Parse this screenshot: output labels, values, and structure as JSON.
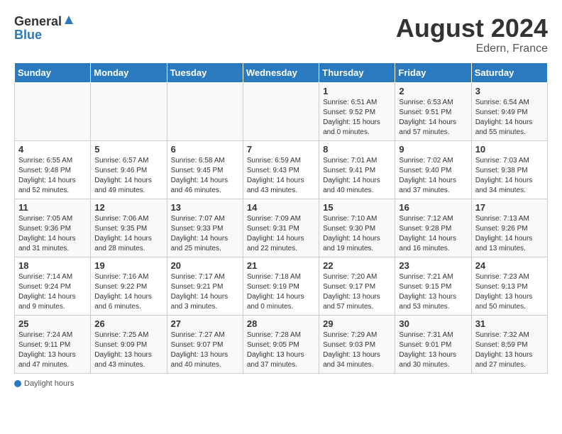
{
  "header": {
    "logo_general": "General",
    "logo_blue": "Blue",
    "month_year": "August 2024",
    "location": "Edern, France"
  },
  "days_of_week": [
    "Sunday",
    "Monday",
    "Tuesday",
    "Wednesday",
    "Thursday",
    "Friday",
    "Saturday"
  ],
  "weeks": [
    [
      {
        "day": "",
        "detail": ""
      },
      {
        "day": "",
        "detail": ""
      },
      {
        "day": "",
        "detail": ""
      },
      {
        "day": "",
        "detail": ""
      },
      {
        "day": "1",
        "detail": "Sunrise: 6:51 AM\nSunset: 9:52 PM\nDaylight: 15 hours\nand 0 minutes."
      },
      {
        "day": "2",
        "detail": "Sunrise: 6:53 AM\nSunset: 9:51 PM\nDaylight: 14 hours\nand 57 minutes."
      },
      {
        "day": "3",
        "detail": "Sunrise: 6:54 AM\nSunset: 9:49 PM\nDaylight: 14 hours\nand 55 minutes."
      }
    ],
    [
      {
        "day": "4",
        "detail": "Sunrise: 6:55 AM\nSunset: 9:48 PM\nDaylight: 14 hours\nand 52 minutes."
      },
      {
        "day": "5",
        "detail": "Sunrise: 6:57 AM\nSunset: 9:46 PM\nDaylight: 14 hours\nand 49 minutes."
      },
      {
        "day": "6",
        "detail": "Sunrise: 6:58 AM\nSunset: 9:45 PM\nDaylight: 14 hours\nand 46 minutes."
      },
      {
        "day": "7",
        "detail": "Sunrise: 6:59 AM\nSunset: 9:43 PM\nDaylight: 14 hours\nand 43 minutes."
      },
      {
        "day": "8",
        "detail": "Sunrise: 7:01 AM\nSunset: 9:41 PM\nDaylight: 14 hours\nand 40 minutes."
      },
      {
        "day": "9",
        "detail": "Sunrise: 7:02 AM\nSunset: 9:40 PM\nDaylight: 14 hours\nand 37 minutes."
      },
      {
        "day": "10",
        "detail": "Sunrise: 7:03 AM\nSunset: 9:38 PM\nDaylight: 14 hours\nand 34 minutes."
      }
    ],
    [
      {
        "day": "11",
        "detail": "Sunrise: 7:05 AM\nSunset: 9:36 PM\nDaylight: 14 hours\nand 31 minutes."
      },
      {
        "day": "12",
        "detail": "Sunrise: 7:06 AM\nSunset: 9:35 PM\nDaylight: 14 hours\nand 28 minutes."
      },
      {
        "day": "13",
        "detail": "Sunrise: 7:07 AM\nSunset: 9:33 PM\nDaylight: 14 hours\nand 25 minutes."
      },
      {
        "day": "14",
        "detail": "Sunrise: 7:09 AM\nSunset: 9:31 PM\nDaylight: 14 hours\nand 22 minutes."
      },
      {
        "day": "15",
        "detail": "Sunrise: 7:10 AM\nSunset: 9:30 PM\nDaylight: 14 hours\nand 19 minutes."
      },
      {
        "day": "16",
        "detail": "Sunrise: 7:12 AM\nSunset: 9:28 PM\nDaylight: 14 hours\nand 16 minutes."
      },
      {
        "day": "17",
        "detail": "Sunrise: 7:13 AM\nSunset: 9:26 PM\nDaylight: 14 hours\nand 13 minutes."
      }
    ],
    [
      {
        "day": "18",
        "detail": "Sunrise: 7:14 AM\nSunset: 9:24 PM\nDaylight: 14 hours\nand 9 minutes."
      },
      {
        "day": "19",
        "detail": "Sunrise: 7:16 AM\nSunset: 9:22 PM\nDaylight: 14 hours\nand 6 minutes."
      },
      {
        "day": "20",
        "detail": "Sunrise: 7:17 AM\nSunset: 9:21 PM\nDaylight: 14 hours\nand 3 minutes."
      },
      {
        "day": "21",
        "detail": "Sunrise: 7:18 AM\nSunset: 9:19 PM\nDaylight: 14 hours\nand 0 minutes."
      },
      {
        "day": "22",
        "detail": "Sunrise: 7:20 AM\nSunset: 9:17 PM\nDaylight: 13 hours\nand 57 minutes."
      },
      {
        "day": "23",
        "detail": "Sunrise: 7:21 AM\nSunset: 9:15 PM\nDaylight: 13 hours\nand 53 minutes."
      },
      {
        "day": "24",
        "detail": "Sunrise: 7:23 AM\nSunset: 9:13 PM\nDaylight: 13 hours\nand 50 minutes."
      }
    ],
    [
      {
        "day": "25",
        "detail": "Sunrise: 7:24 AM\nSunset: 9:11 PM\nDaylight: 13 hours\nand 47 minutes."
      },
      {
        "day": "26",
        "detail": "Sunrise: 7:25 AM\nSunset: 9:09 PM\nDaylight: 13 hours\nand 43 minutes."
      },
      {
        "day": "27",
        "detail": "Sunrise: 7:27 AM\nSunset: 9:07 PM\nDaylight: 13 hours\nand 40 minutes."
      },
      {
        "day": "28",
        "detail": "Sunrise: 7:28 AM\nSunset: 9:05 PM\nDaylight: 13 hours\nand 37 minutes."
      },
      {
        "day": "29",
        "detail": "Sunrise: 7:29 AM\nSunset: 9:03 PM\nDaylight: 13 hours\nand 34 minutes."
      },
      {
        "day": "30",
        "detail": "Sunrise: 7:31 AM\nSunset: 9:01 PM\nDaylight: 13 hours\nand 30 minutes."
      },
      {
        "day": "31",
        "detail": "Sunrise: 7:32 AM\nSunset: 8:59 PM\nDaylight: 13 hours\nand 27 minutes."
      }
    ]
  ],
  "footer": {
    "text": "Daylight hours"
  }
}
